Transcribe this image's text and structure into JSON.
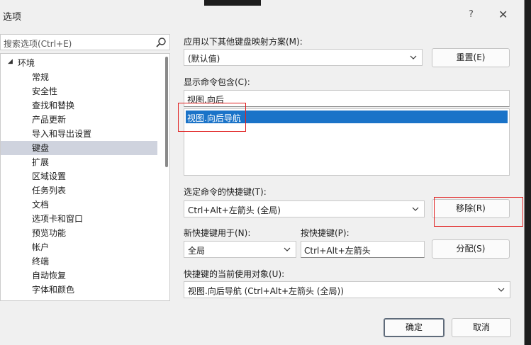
{
  "window": {
    "title": "选项",
    "help": "?",
    "close": "✕"
  },
  "search": {
    "placeholder": "搜索选项(Ctrl+E)"
  },
  "tree": {
    "root": "环境",
    "items": [
      "常规",
      "安全性",
      "查找和替换",
      "产品更新",
      "导入和导出设置",
      "键盘",
      "扩展",
      "区域设置",
      "任务列表",
      "文档",
      "选项卡和窗口",
      "预览功能",
      "帐户",
      "终端",
      "自动恢复",
      "字体和颜色"
    ],
    "selected": "键盘"
  },
  "scheme": {
    "label": "应用以下其他键盘映射方案(M):",
    "value": "(默认值)",
    "reset": "重置(E)"
  },
  "commands": {
    "label": "显示命令包含(C):",
    "filter": "视图.向后",
    "selected_item": "视图.向后导航"
  },
  "shortcuts": {
    "label": "选定命令的快捷键(T):",
    "value": "Ctrl+Alt+左箭头 (全局)",
    "remove": "移除(R)"
  },
  "newShortcut": {
    "label": "新快捷键用于(N):",
    "value": "全局"
  },
  "pressKeys": {
    "label": "按快捷键(P):",
    "value": "Ctrl+Alt+左箭头",
    "assign": "分配(S)"
  },
  "usedBy": {
    "label": "快捷键的当前使用对象(U):",
    "value": "视图.向后导航 (Ctrl+Alt+左箭头 (全局))"
  },
  "footer": {
    "ok": "确定",
    "cancel": "取消"
  }
}
